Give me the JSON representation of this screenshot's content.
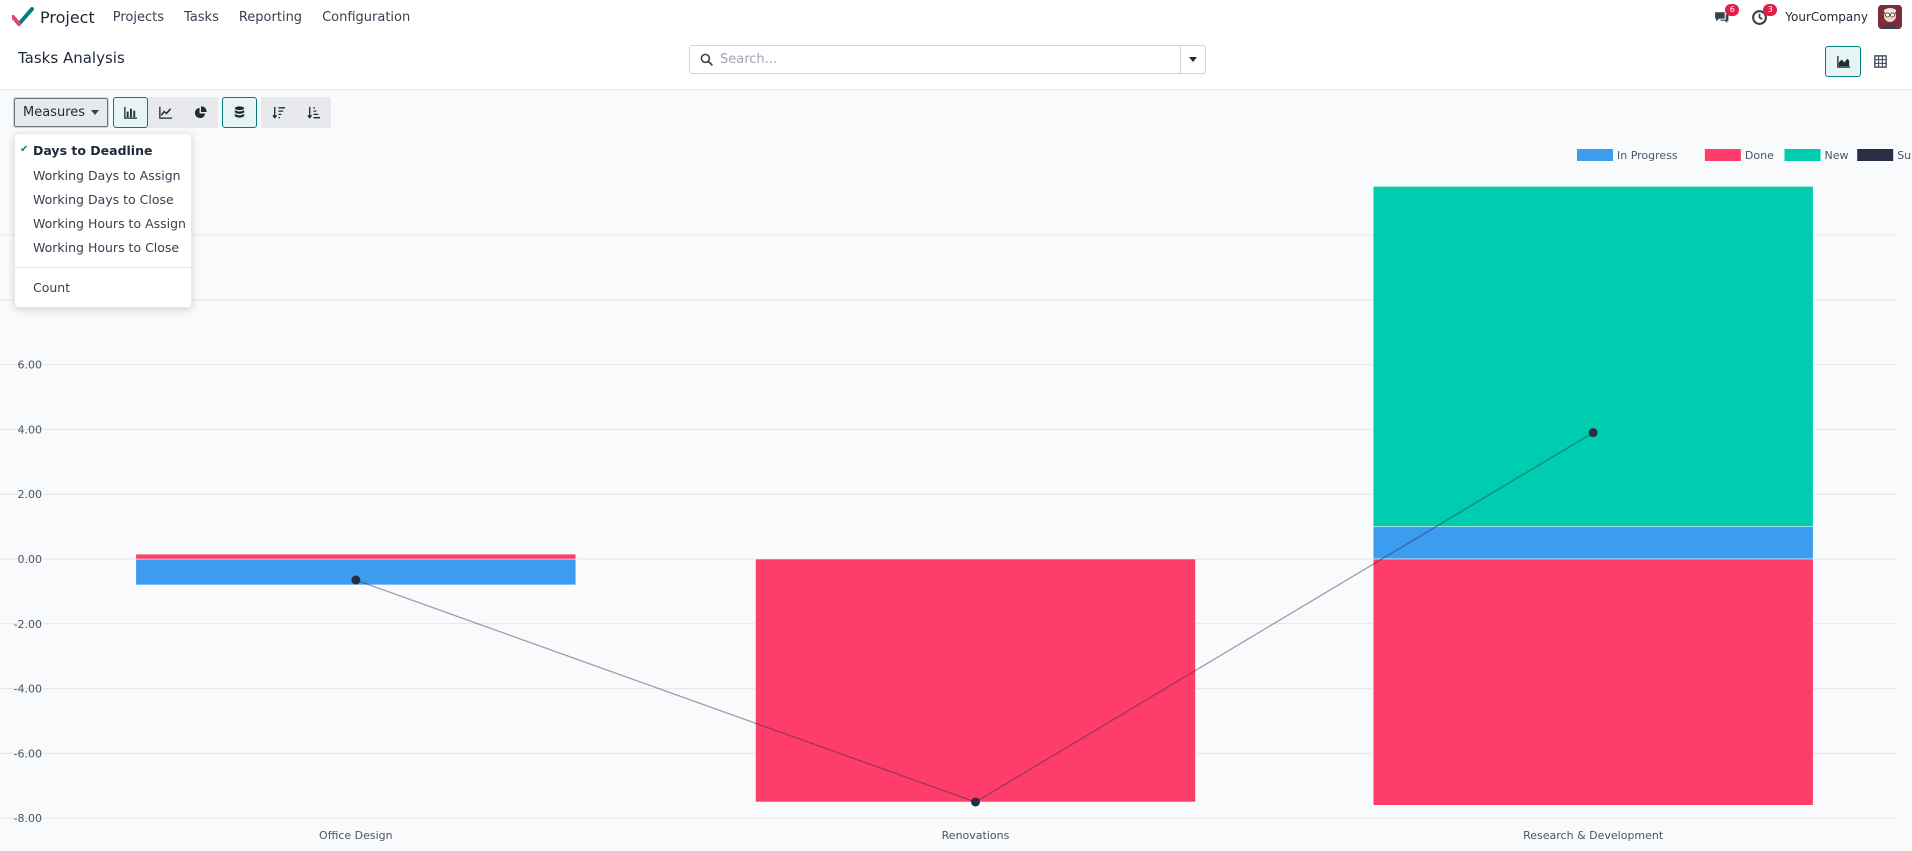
{
  "app": {
    "name": "Project"
  },
  "nav": {
    "items": [
      "Projects",
      "Tasks",
      "Reporting",
      "Configuration"
    ]
  },
  "systray": {
    "messages_count": "6",
    "activities_count": "3",
    "company": "YourCompany"
  },
  "page": {
    "title": "Tasks Analysis"
  },
  "search": {
    "placeholder": "Search..."
  },
  "toolbar": {
    "measures_label": "Measures"
  },
  "measures_menu": {
    "items": [
      {
        "label": "Days to Deadline",
        "selected": true
      },
      {
        "label": "Working Days to Assign",
        "selected": false
      },
      {
        "label": "Working Days to Close",
        "selected": false
      },
      {
        "label": "Working Hours to Assign",
        "selected": false
      },
      {
        "label": "Working Hours to Close",
        "selected": false
      }
    ],
    "count_label": "Count"
  },
  "colors": {
    "accent": "#017e84",
    "in_progress": "#3b9cf0",
    "done": "#ff3d6a",
    "new": "#00ccb0",
    "sum": "#2a2e44"
  },
  "chart_data": {
    "type": "bar",
    "stacked": true,
    "categories": [
      "Office Design",
      "Renovations",
      "Research & Development"
    ],
    "series": [
      {
        "name": "In Progress",
        "color": "#3b9cf0",
        "values": [
          -0.8,
          0,
          1.0
        ]
      },
      {
        "name": "Done",
        "color": "#ff3d6a",
        "values": [
          0.15,
          -7.5,
          -7.6
        ]
      },
      {
        "name": "New",
        "color": "#00ccb0",
        "values": [
          0,
          0,
          10.5
        ]
      }
    ],
    "line_series": {
      "name": "Sum",
      "color": "#2a2e44",
      "values": [
        -0.65,
        -7.5,
        3.9
      ]
    },
    "y_ticks": [
      "-8.00",
      "-6.00",
      "-4.00",
      "-2.00",
      "0.00",
      "2.00",
      "4.00",
      "6.00"
    ],
    "ylim": [
      -8,
      12
    ],
    "legend_position": "top-right",
    "grid": true
  }
}
